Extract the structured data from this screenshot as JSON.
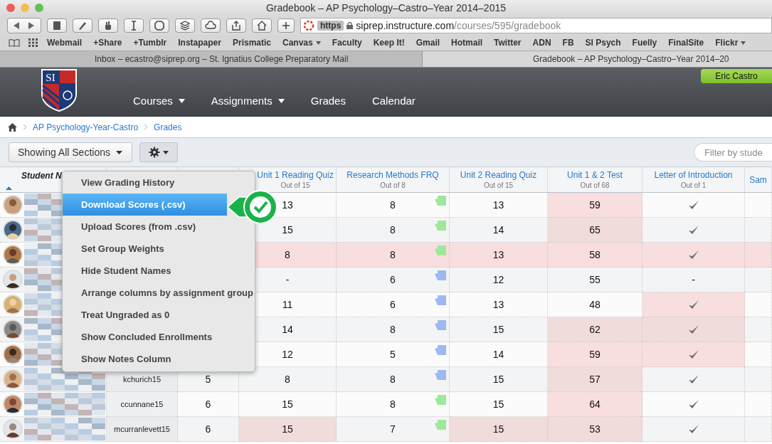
{
  "window": {
    "title": "Gradebook – AP Psychology–Castro–Year 2014–2015"
  },
  "address_bar": {
    "scheme": "https",
    "host": "siprep.instructure.com",
    "path": "/courses/595/gradebook"
  },
  "bookmarks": [
    {
      "label": "Webmail",
      "menu": false
    },
    {
      "label": "+Share",
      "menu": false
    },
    {
      "label": "+Tumblr",
      "menu": false
    },
    {
      "label": "Instapaper",
      "menu": false
    },
    {
      "label": "Prismatic",
      "menu": false
    },
    {
      "label": "Canvas",
      "menu": true
    },
    {
      "label": "Faculty",
      "menu": false
    },
    {
      "label": "Keep It!",
      "menu": false
    },
    {
      "label": "Gmail",
      "menu": false
    },
    {
      "label": "Hotmail",
      "menu": false
    },
    {
      "label": "Twitter",
      "menu": false
    },
    {
      "label": "ADN",
      "menu": false
    },
    {
      "label": "FB",
      "menu": false
    },
    {
      "label": "SI Psych",
      "menu": false
    },
    {
      "label": "Fuelly",
      "menu": false
    },
    {
      "label": "FinalSite",
      "menu": false
    },
    {
      "label": "Flickr",
      "menu": true
    }
  ],
  "tabs": [
    {
      "label": "Inbox – ecastro@siprep.org – St. Ignatius College Preparatory Mail",
      "selected": false
    },
    {
      "label": "Gradebook – AP Psychology–Castro–Year 2014–20",
      "selected": true
    }
  ],
  "header": {
    "logo_text": "SI",
    "user": "Eric Castro",
    "nav": [
      {
        "label": "Courses",
        "menu": true
      },
      {
        "label": "Assignments",
        "menu": true
      },
      {
        "label": "Grades",
        "menu": false
      },
      {
        "label": "Calendar",
        "menu": false
      }
    ]
  },
  "breadcrumb": [
    "AP Psychology-Year-Castro",
    "Grades"
  ],
  "toolbar": {
    "sections": "Showing All Sections",
    "settings_expanded": true,
    "filter_placeholder": "Filter by stude"
  },
  "settings_menu": [
    {
      "label": "View Grading History",
      "selected": false
    },
    {
      "label": "Download Scores (.csv)",
      "selected": true
    },
    {
      "label": "Upload Scores (from .csv)",
      "selected": false
    },
    {
      "label": "Set Group Weights",
      "selected": false
    },
    {
      "label": "Hide Student Names",
      "selected": false
    },
    {
      "label": "Arrange columns by assignment group",
      "selected": false
    },
    {
      "label": "Treat Ungraded as 0",
      "selected": false
    },
    {
      "label": "Show Concluded Enrollments",
      "selected": false
    },
    {
      "label": "Show Notes Column",
      "selected": false
    }
  ],
  "table": {
    "name_header": "Student N",
    "columns": [
      {
        "title": "Unit 1 Reading Quiz",
        "points": "Out of 15"
      },
      {
        "title": "Research Methods FRQ",
        "points": "Out of 8"
      },
      {
        "title": "Unit 2 Reading Quiz",
        "points": "Out of 15"
      },
      {
        "title": "Unit 1 & 2 Test",
        "points": "Out of 68"
      },
      {
        "title": "Letter of Introduction",
        "points": "Out of 1"
      },
      {
        "title": "Sam"
      }
    ],
    "rows": [
      {
        "cells": [
          {
            "kind": "number",
            "text": "13",
            "highlight": false
          },
          {
            "kind": "number",
            "text": "8",
            "highlight": false,
            "flag": {
              "color": "#9ee89b"
            }
          },
          {
            "kind": "number",
            "text": "13",
            "highlight": false
          },
          {
            "kind": "number",
            "text": "59",
            "highlight": true
          },
          {
            "kind": "check",
            "highlight": false
          },
          {
            "kind": "empty",
            "highlight": false
          }
        ]
      },
      {
        "cells": [
          {
            "kind": "number",
            "text": "15",
            "highlight": false
          },
          {
            "kind": "number",
            "text": "8",
            "highlight": false,
            "flag": {
              "color": "#9ee89b"
            }
          },
          {
            "kind": "number",
            "text": "14",
            "highlight": false
          },
          {
            "kind": "number",
            "text": "65",
            "highlight": true
          },
          {
            "kind": "check",
            "highlight": false
          },
          {
            "kind": "empty",
            "highlight": false
          }
        ]
      },
      {
        "cells": [
          {
            "kind": "number",
            "text": "8",
            "highlight": true
          },
          {
            "kind": "number",
            "text": "8",
            "highlight": true,
            "flag": {
              "color": "#9ee89b"
            }
          },
          {
            "kind": "number",
            "text": "13",
            "highlight": true
          },
          {
            "kind": "number",
            "text": "58",
            "highlight": true
          },
          {
            "kind": "check",
            "highlight": true
          },
          {
            "kind": "empty",
            "highlight": true
          }
        ]
      },
      {
        "cells": [
          {
            "kind": "number",
            "text": "-",
            "highlight": false
          },
          {
            "kind": "number",
            "text": "6",
            "highlight": false,
            "flag": {
              "color": "#9db9f2"
            }
          },
          {
            "kind": "number",
            "text": "12",
            "highlight": false
          },
          {
            "kind": "number",
            "text": "55",
            "highlight": false
          },
          {
            "kind": "number",
            "text": "-",
            "highlight": false
          },
          {
            "kind": "empty",
            "highlight": false
          }
        ]
      },
      {
        "cells": [
          {
            "kind": "number",
            "text": "11",
            "highlight": false
          },
          {
            "kind": "number",
            "text": "6",
            "highlight": false,
            "flag": {
              "color": "#9db9f2"
            }
          },
          {
            "kind": "number",
            "text": "13",
            "highlight": false
          },
          {
            "kind": "number",
            "text": "48",
            "highlight": false
          },
          {
            "kind": "check",
            "highlight": true
          },
          {
            "kind": "empty",
            "highlight": false
          }
        ]
      },
      {
        "cells": [
          {
            "kind": "number",
            "text": "14",
            "highlight": false
          },
          {
            "kind": "number",
            "text": "8",
            "highlight": false,
            "flag": {
              "color": "#9db9f2"
            }
          },
          {
            "kind": "number",
            "text": "15",
            "highlight": false
          },
          {
            "kind": "number",
            "text": "62",
            "highlight": true
          },
          {
            "kind": "check",
            "highlight": true
          },
          {
            "kind": "empty",
            "highlight": false
          }
        ]
      },
      {
        "cells": [
          {
            "kind": "number",
            "text": "12",
            "highlight": false
          },
          {
            "kind": "number",
            "text": "5",
            "highlight": false,
            "flag": {
              "color": "#9db9f2"
            }
          },
          {
            "kind": "number",
            "text": "14",
            "highlight": false
          },
          {
            "kind": "number",
            "text": "59",
            "highlight": true
          },
          {
            "kind": "check",
            "highlight": true
          },
          {
            "kind": "empty",
            "highlight": false
          }
        ]
      },
      {
        "login": "kchurich15",
        "points": "5",
        "cells": [
          {
            "kind": "number",
            "text": "8",
            "highlight": false
          },
          {
            "kind": "number",
            "text": "8",
            "highlight": false,
            "flag": {
              "color": "#9db9f2"
            }
          },
          {
            "kind": "number",
            "text": "15",
            "highlight": false
          },
          {
            "kind": "number",
            "text": "57",
            "highlight": true
          },
          {
            "kind": "check",
            "highlight": false
          },
          {
            "kind": "empty",
            "highlight": false
          }
        ]
      },
      {
        "login": "ccunnane15",
        "points": "6",
        "cells": [
          {
            "kind": "number",
            "text": "15",
            "highlight": false
          },
          {
            "kind": "number",
            "text": "8",
            "highlight": false,
            "flag": {
              "color": "#9ee89b"
            }
          },
          {
            "kind": "number",
            "text": "15",
            "highlight": false
          },
          {
            "kind": "number",
            "text": "64",
            "highlight": true
          },
          {
            "kind": "check",
            "highlight": false
          },
          {
            "kind": "empty",
            "highlight": false
          }
        ]
      },
      {
        "login": "mcurranlevett15",
        "points": "6",
        "cells": [
          {
            "kind": "number",
            "text": "15",
            "highlight": true
          },
          {
            "kind": "number",
            "text": "7",
            "highlight": false,
            "flag": {
              "color": "#9ee89b"
            }
          },
          {
            "kind": "number",
            "text": "15",
            "highlight": true
          },
          {
            "kind": "number",
            "text": "53",
            "highlight": true
          },
          {
            "kind": "check",
            "highlight": false
          },
          {
            "kind": "empty",
            "highlight": false
          }
        ]
      }
    ]
  }
}
